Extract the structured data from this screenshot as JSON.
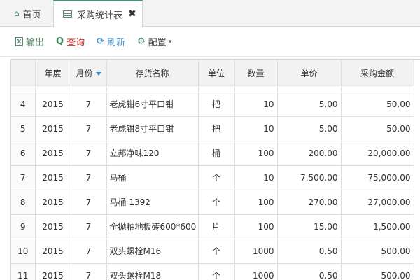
{
  "tabs": {
    "home": "首页",
    "active": "采购统计表",
    "close": "✖"
  },
  "toolbar": {
    "export": "输出",
    "query": "查询",
    "refresh": "刷新",
    "config": "配置"
  },
  "table": {
    "headers": [
      "年度",
      "月份",
      "存货名称",
      "单位",
      "数量",
      "单价",
      "采购金额"
    ],
    "rows": [
      {
        "idx": "4",
        "year": "2015",
        "month": "7",
        "name": "老虎钳6寸平口钳",
        "unit": "把",
        "qty": "10",
        "price": "5.00",
        "amount": "50.00"
      },
      {
        "idx": "5",
        "year": "2015",
        "month": "7",
        "name": "老虎钳8寸平口钳",
        "unit": "把",
        "qty": "10",
        "price": "5.00",
        "amount": "50.00"
      },
      {
        "idx": "6",
        "year": "2015",
        "month": "7",
        "name": "立邦净味120",
        "unit": "桶",
        "qty": "100",
        "price": "200.00",
        "amount": "20,000.00"
      },
      {
        "idx": "7",
        "year": "2015",
        "month": "7",
        "name": "马桶",
        "unit": "个",
        "qty": "10",
        "price": "7,500.00",
        "amount": "75,000.00"
      },
      {
        "idx": "8",
        "year": "2015",
        "month": "7",
        "name": "马桶 1392",
        "unit": "个",
        "qty": "100",
        "price": "270.00",
        "amount": "27,000.00"
      },
      {
        "idx": "9",
        "year": "2015",
        "month": "7",
        "name": "全抛釉地板砖600*600",
        "unit": "片",
        "qty": "100",
        "price": "15.00",
        "amount": "1,500.00"
      },
      {
        "idx": "10",
        "year": "2015",
        "month": "7",
        "name": "双头螺栓M16",
        "unit": "个",
        "qty": "1000",
        "price": "0.50",
        "amount": "500.00"
      },
      {
        "idx": "11",
        "year": "2015",
        "month": "7",
        "name": "双头螺栓M18",
        "unit": "个",
        "qty": "1000",
        "price": "0.50",
        "amount": "500.00"
      }
    ]
  },
  "icons": {
    "home": "home-icon",
    "table": "table-icon",
    "export": "excel-icon",
    "query": "search-icon",
    "refresh": "refresh-icon",
    "config": "gear-icon",
    "sort": "sort-desc-icon"
  },
  "colors": {
    "accent": "#4d8b73",
    "query_text": "#c9302c",
    "refresh_text": "#4e92c7",
    "sort_caret": "#3a8dc9"
  }
}
